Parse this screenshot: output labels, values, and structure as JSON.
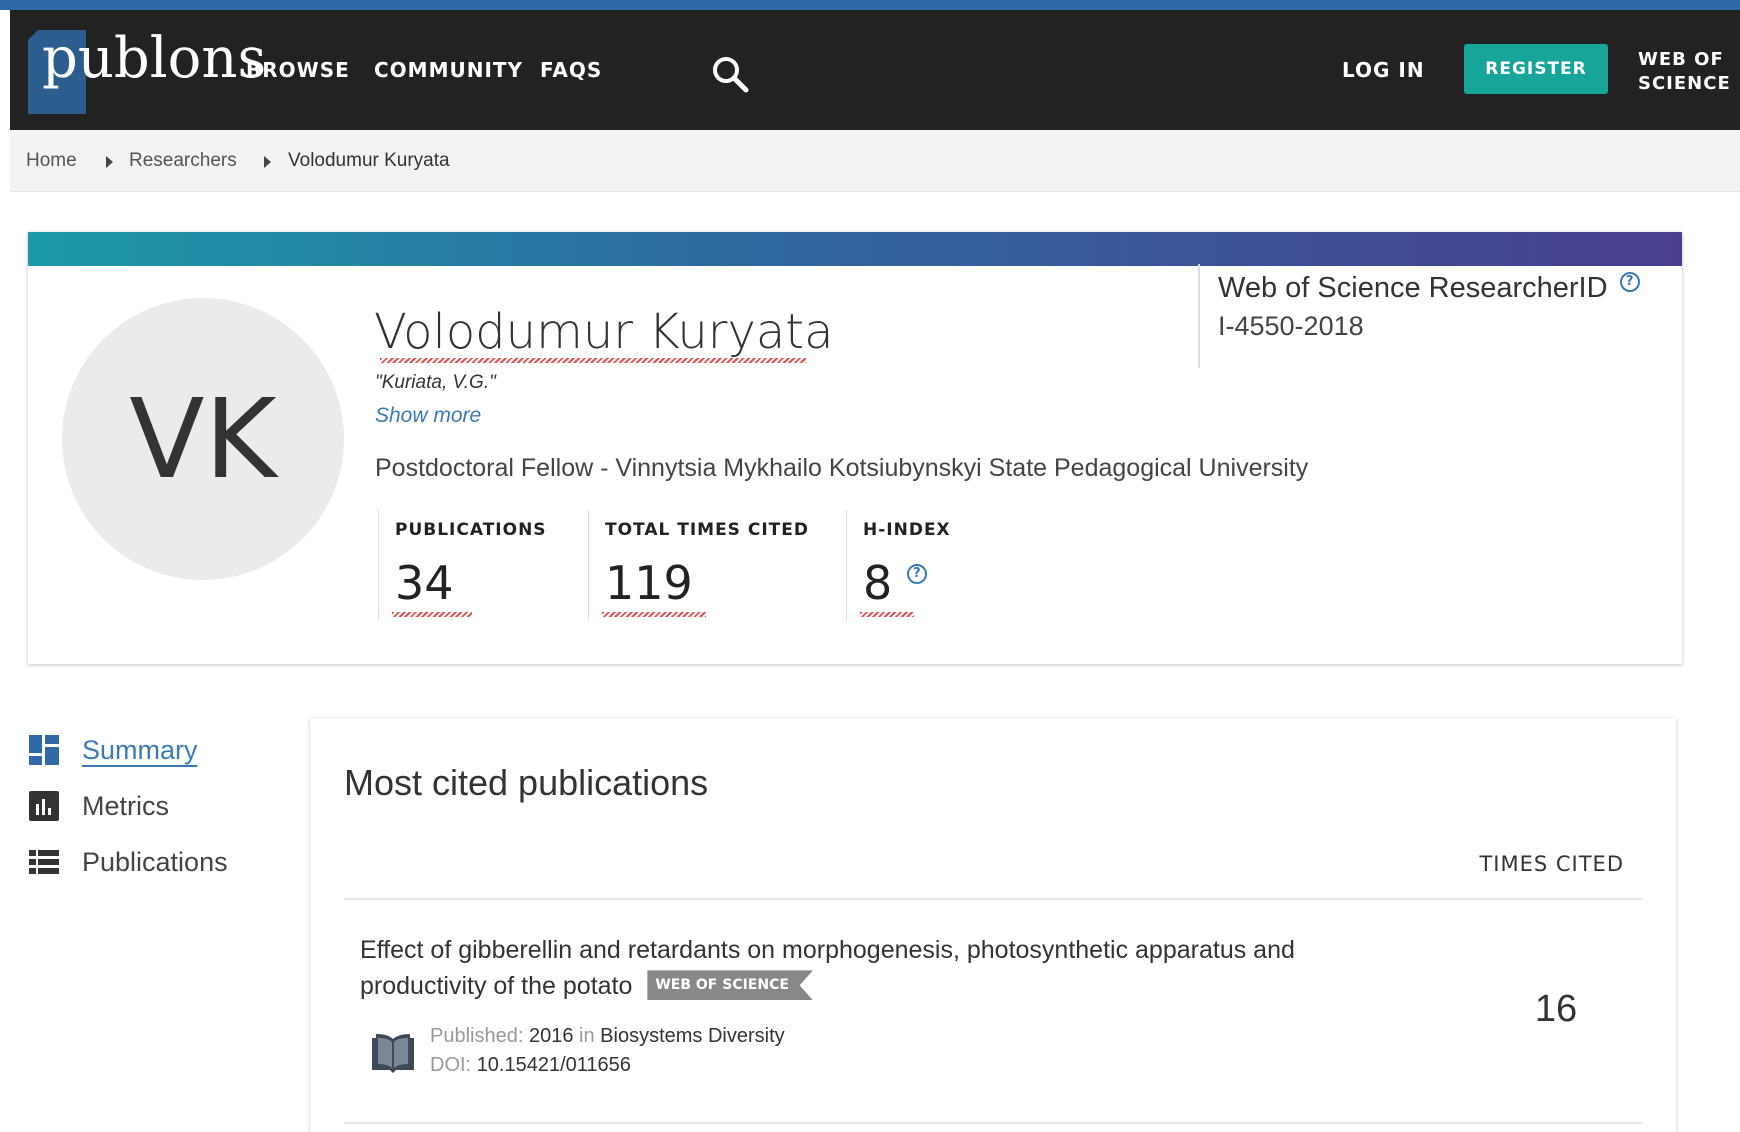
{
  "header": {
    "logo_text": "publons",
    "nav": [
      "BROWSE",
      "COMMUNITY",
      "FAQS"
    ],
    "search_icon": "search-icon",
    "login_label": "LOG IN",
    "register_label": "REGISTER",
    "wos_line1": "WEB OF",
    "wos_line2": "SCIENCE",
    "colors": {
      "header_bg": "#222222",
      "register_bg": "#17a59a",
      "logo_blue": "#2b5e8e"
    }
  },
  "breadcrumb": {
    "items": [
      "Home",
      "Researchers",
      "Volodumur Kuryata"
    ]
  },
  "profile": {
    "initials": "VK",
    "name": "Volodumur Kuryata",
    "alias": "\"Kuriata, V.G.\"",
    "show_more": "Show more",
    "affiliation": "Postdoctoral Fellow - Vinnytsia Mykhailo Kotsiubynskyi State Pedagogical University",
    "researcher_id_label": "Web of Science ResearcherID",
    "researcher_id": "I-4550-2018",
    "metrics": [
      {
        "label": "PUBLICATIONS",
        "value": "34"
      },
      {
        "label": "TOTAL TIMES CITED",
        "value": "119"
      },
      {
        "label": "H-INDEX",
        "value": "8"
      }
    ],
    "help_glyph": "?"
  },
  "sidebar": {
    "items": [
      {
        "label": "Summary",
        "icon": "dashboard-icon",
        "active": true
      },
      {
        "label": "Metrics",
        "icon": "bar-chart-icon",
        "active": false
      },
      {
        "label": "Publications",
        "icon": "list-icon",
        "active": false
      }
    ]
  },
  "main": {
    "card_title": "Most cited publications",
    "column_header": "TIMES CITED",
    "publications": [
      {
        "title": "Effect of gibberellin and retardants on morphogenesis, photosynthetic apparatus and productivity of the potato",
        "badge": "WEB OF SCIENCE",
        "published_key": "Published:",
        "year": "2016",
        "in_key": "in",
        "journal": "Biosystems Diversity",
        "doi_key": "DOI:",
        "doi": "10.15421/011656",
        "times_cited": "16"
      }
    ]
  }
}
